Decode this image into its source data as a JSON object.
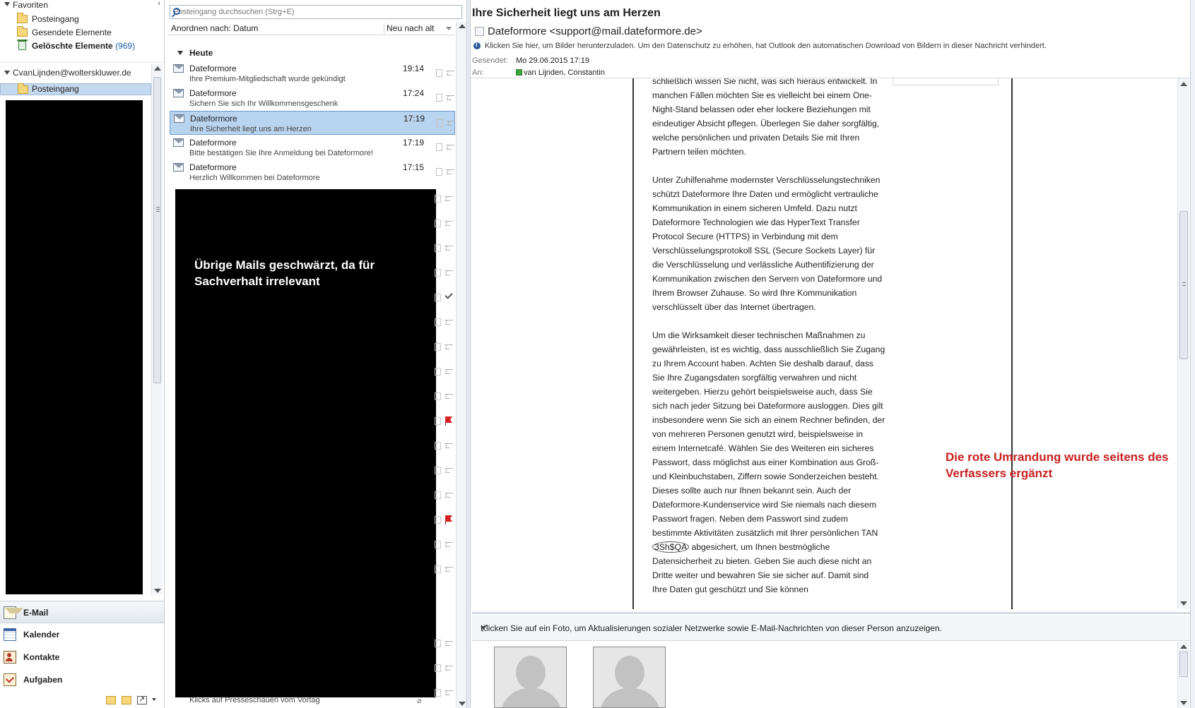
{
  "nav": {
    "favorites_label": "Favoriten",
    "favorites": [
      {
        "label": "Posteingang",
        "count": ""
      },
      {
        "label": "Gesendete Elemente",
        "count": ""
      },
      {
        "label": "Gelöschte Elemente",
        "count": "(969)"
      }
    ],
    "account": "CvanLijnden@wolterskluwer.de",
    "selected_folder": "Posteingang",
    "modules": [
      {
        "label": "E-Mail",
        "icon": "mail-icon"
      },
      {
        "label": "Kalender",
        "icon": "calendar-icon"
      },
      {
        "label": "Kontakte",
        "icon": "contacts-icon"
      },
      {
        "label": "Aufgaben",
        "icon": "tasks-icon"
      }
    ]
  },
  "list": {
    "search_placeholder": "Posteingang durchsuchen (Strg+E)",
    "arrange_label": "Anordnen nach: Datum",
    "sort_label": "Neu nach alt",
    "group_label": "Heute",
    "messages": [
      {
        "from": "Dateformore",
        "subject": "Ihre Premium-Mitgliedschaft wurde gekündigt",
        "time": "19:14"
      },
      {
        "from": "Dateformore",
        "subject": "Sichern Sie sich Ihr Willkommensgeschenk",
        "time": "17:24"
      },
      {
        "from": "Dateformore",
        "subject": "Ihre Sicherheit liegt uns am Herzen",
        "time": "17:19"
      },
      {
        "from": "Dateformore",
        "subject": "Bitte bestätigen Sie Ihre Anmeldung bei Dateformore!",
        "time": "17:19"
      },
      {
        "from": "Dateformore",
        "subject": "Herzlich Willkommen bei Dateformore",
        "time": "17:15"
      }
    ],
    "redaction_note": "Übrige Mails geschwärzt, da für Sachverhalt irrelevant",
    "last_visible_subject": "Klicks auf Presseschauen vom Vortag"
  },
  "reading": {
    "subject": "Ihre Sicherheit liegt uns am Herzen",
    "from": "Dateformore <support@mail.dateformore.de>",
    "info_bar": "Klicken Sie hier, um Bilder herunterzuladen. Um den Datenschutz zu erhöhen, hat Outlook den automatischen Download von Bildern in dieser Nachricht verhindert.",
    "sent_label": "Gesendet:",
    "sent_value": "Mo 29.06.2015 17:19",
    "to_label": "An:",
    "to_value": "van Lijnden, Constantin",
    "body_p1": "schließlich wissen Sie nicht, was sich hieraus entwickelt. In manchen Fällen möchten Sie es vielleicht bei einem One-Night-Stand belassen oder eher lockere Beziehungen mit eindeutiger Absicht pflegen. Überlegen Sie daher sorgfältig, welche persönlichen und privaten Details Sie mit Ihren Partnern teilen möchten.",
    "body_p2": "Unter Zuhilfenahme modernster Verschlüsselungstechniken schützt Dateformore Ihre Daten und ermöglicht vertrauliche Kommunikation in einem sicheren Umfeld. Dazu nutzt Dateformore Technologien wie das HyperText Transfer Protocol Secure (HTTPS) in Verbindung mit dem Verschlüsselungsprotokoll SSL (Secure Sockets Layer) für die Verschlüsselung und verlässliche Authentifizierung der Kommunikation zwischen den Servern von Dateformore und Ihrem Browser Zuhause. So wird Ihre Kommunikation verschlüsselt über das Internet übertragen.",
    "body_p3_a": "Um die Wirksamkeit dieser technischen Maßnahmen zu gewährleisten, ist es wichtig, dass ausschließlich Sie Zugang zu Ihrem Account haben. Achten Sie deshalb darauf, dass Sie Ihre Zugangsdaten sorgfältig verwahren und nicht weitergeben. Hierzu gehört beispielsweise auch, dass Sie sich nach jeder Sitzung bei Dateformore ausloggen. Dies gilt insbesondere wenn Sie sich an einem Rechner befinden, der von mehreren Personen genutzt wird, beispielsweise in einem Internetcafé. Wählen Sie des Weiteren ein sicheres Passwort, dass möglichst aus einer Kombination aus Groß- und Kleinbuchstaben, Ziffern sowie Sonderzeichen besteht. Dieses sollte auch nur Ihnen bekannt sein. Auch der Dateformore-Kundenservice wird Sie niemals nach diesem Passwort fragen. Neben dem Passwort sind zudem bestimmte Aktivitäten zusätzlich mit Ihrer persönlichen TAN",
    "body_tan": "3Sh$QA",
    "body_p3_b": "abgesichert, um Ihnen bestmögliche Datensicherheit zu bieten. Geben Sie auch diese nicht an Dritte weiter und bewahren Sie sie sicher auf. Damit sind Ihre Daten gut geschützt und Sie können",
    "annotation": "Die rote Umrandung wurde seitens des Verfassers ergänzt",
    "social_bar": "Klicken Sie auf ein Foto, um Aktualisierungen sozialer Netzwerke sowie E-Mail-Nachrichten von dieser Person anzuzeigen."
  },
  "colors": {
    "selection": "#b9d4ef",
    "redaction": "#000000",
    "annotation": "#c82020"
  }
}
